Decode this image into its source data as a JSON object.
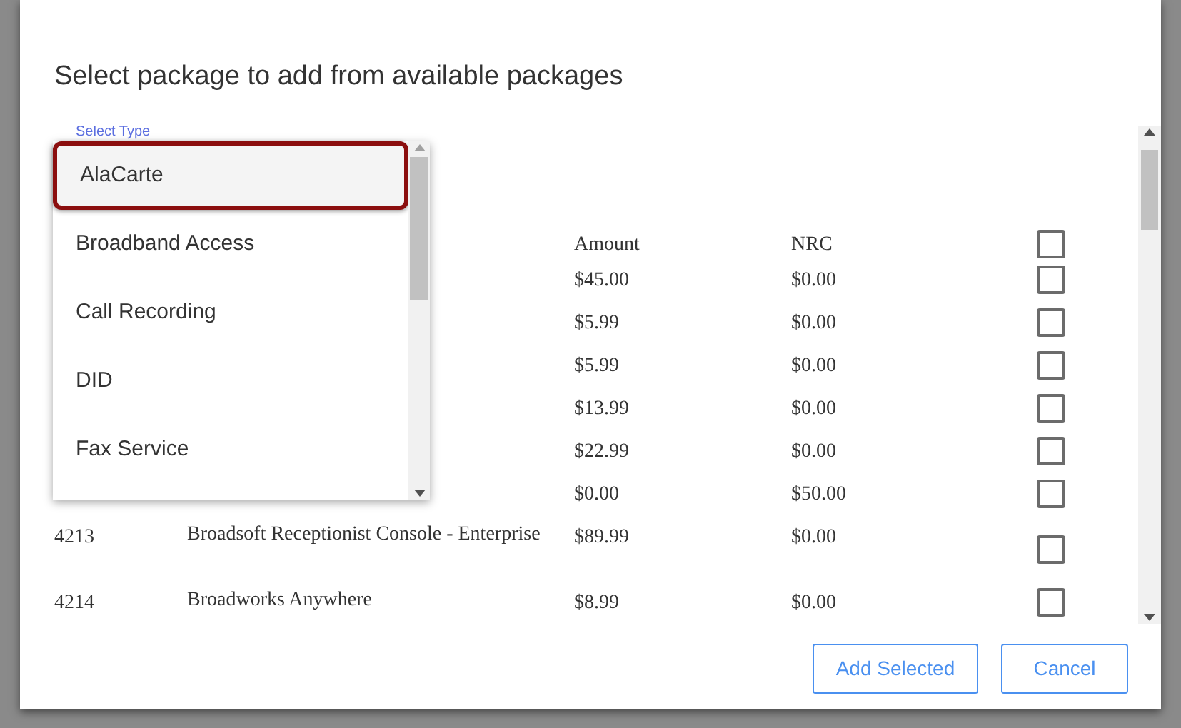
{
  "dialog": {
    "title": "Select package to add from available packages"
  },
  "select_type": {
    "label": "Select Type"
  },
  "dropdown": {
    "options": [
      {
        "label": "AlaCarte",
        "selected": true
      },
      {
        "label": "Broadband Access",
        "selected": false
      },
      {
        "label": "Call Recording",
        "selected": false
      },
      {
        "label": "DID",
        "selected": false
      },
      {
        "label": "Fax Service",
        "selected": false
      }
    ]
  },
  "table": {
    "columns": [
      "Amount",
      "NRC"
    ],
    "header_checked": false,
    "rows": [
      {
        "amount": "$45.00",
        "nrc": "$0.00",
        "checked": false
      },
      {
        "amount": "$5.99",
        "nrc": "$0.00",
        "checked": false
      },
      {
        "amount": "$5.99",
        "nrc": "$0.00",
        "checked": false
      },
      {
        "amount": "$13.99",
        "nrc": "$0.00",
        "checked": false
      },
      {
        "amount": "$22.99",
        "nrc": "$0.00",
        "checked": false
      },
      {
        "amount": "$0.00",
        "nrc": "$50.00",
        "checked": false
      },
      {
        "code": "4213",
        "name": "Broadsoft Receptionist Console - Enterprise",
        "amount": "$89.99",
        "nrc": "$0.00",
        "checked": false
      },
      {
        "code": "4214",
        "name": "Broadworks Anywhere",
        "amount": "$8.99",
        "nrc": "$0.00",
        "checked": false
      }
    ]
  },
  "buttons": [
    "Add Selected",
    "Cancel"
  ]
}
